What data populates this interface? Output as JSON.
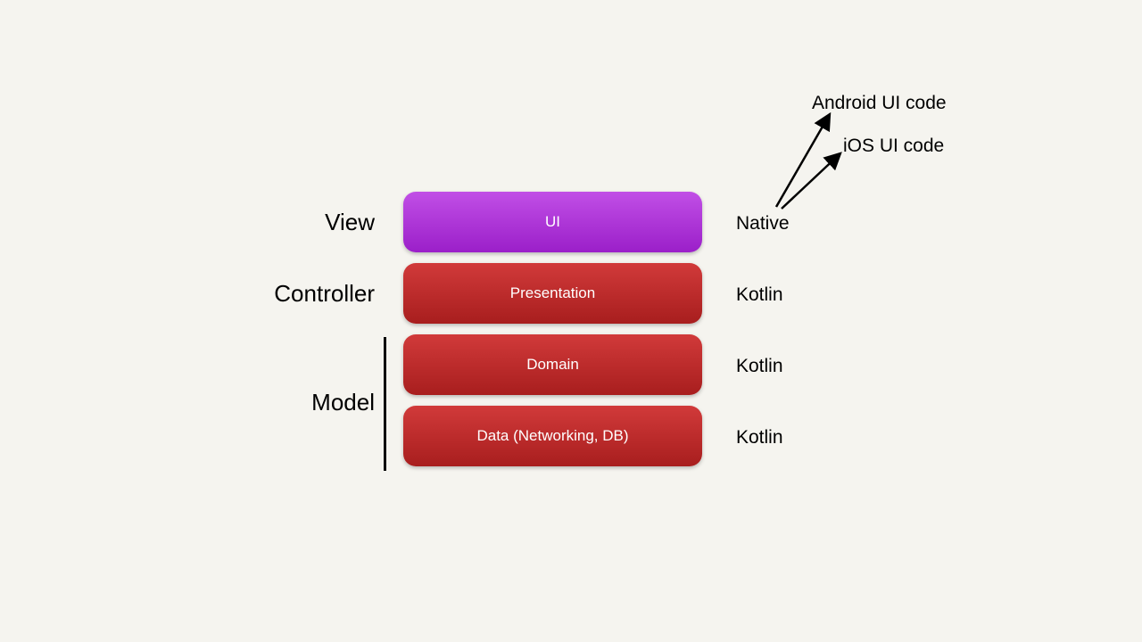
{
  "layers": {
    "view": {
      "left_label": "View",
      "block_label": "UI",
      "right_label": "Native"
    },
    "controller": {
      "left_label": "Controller",
      "block_label": "Presentation",
      "right_label": "Kotlin"
    },
    "domain": {
      "block_label": "Domain",
      "right_label": "Kotlin"
    },
    "data": {
      "block_label": "Data (Networking, DB)",
      "right_label": "Kotlin"
    },
    "model_label": "Model"
  },
  "annotations": {
    "android": "Android UI code",
    "ios": "iOS UI code"
  }
}
